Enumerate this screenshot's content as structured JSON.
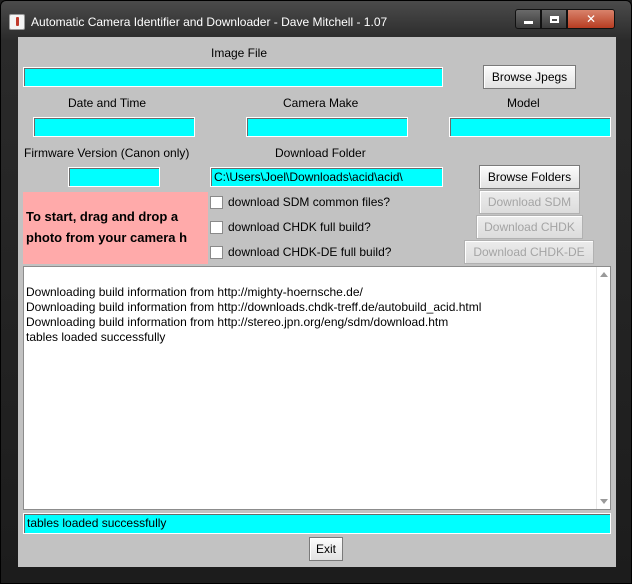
{
  "window": {
    "title": "Automatic Camera Identifier and Downloader - Dave Mitchell - 1.07"
  },
  "labels": {
    "image_file": "Image File",
    "date_time": "Date and Time",
    "camera_make": "Camera Make",
    "model": "Model",
    "firmware": "Firmware Version (Canon only)",
    "download_folder": "Download Folder"
  },
  "fields": {
    "image_file": "",
    "date_time": "",
    "camera_make": "",
    "model": "",
    "firmware": "",
    "download_folder": "C:\\Users\\Joel\\Downloads\\acid\\acid\\"
  },
  "buttons": {
    "browse_jpegs": "Browse Jpegs",
    "browse_folders": "Browse Folders",
    "download_sdm": "Download SDM",
    "download_chdk": "Download CHDK",
    "download_chdk_de": "Download CHDK-DE",
    "exit": "Exit"
  },
  "hint": "To start, drag and drop a\nphoto from your camera h",
  "checkboxes": [
    {
      "label": "download SDM common files?",
      "checked": false
    },
    {
      "label": "download CHDK full build?",
      "checked": false
    },
    {
      "label": "download CHDK-DE full build?",
      "checked": false
    }
  ],
  "log": [
    "Downloading build information from http://mighty-hoernsche.de/",
    "Downloading build information from http://downloads.chdk-treff.de/autobuild_acid.html",
    "Downloading build information from http://stereo.jpn.org/eng/sdm/download.htm",
    "tables loaded successfully"
  ],
  "status": "tables loaded successfully",
  "colors": {
    "field": "#00ffff",
    "hint_bg": "#ffaaaa",
    "panel": "#c2c2c2"
  }
}
